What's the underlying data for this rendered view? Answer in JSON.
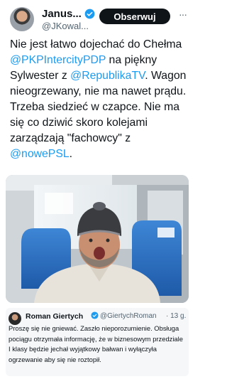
{
  "tweet": {
    "author_name": "Janus...",
    "author_handle": "@JKowal...",
    "follow_label": "Obserwuj",
    "more_label": "···",
    "text_parts": [
      "Nie jest łatwo dojechać do Chełma ",
      "@PKPIntercityPDP",
      " na piękny Sylwester z ",
      "@RepublikaTV",
      ". Wagon nieogrzewany, nie ma nawet prądu. Trzeba siedzieć w czapce. Nie ma się co dziwić skoro kolejami zarządzają \"fachowcy\" z ",
      "@nowePSL",
      "."
    ]
  },
  "reply": {
    "author_name": "Roman Giertych",
    "author_handle": "@GiertychRoman",
    "time": "· 13 g.",
    "text": "Proszę się nie gniewać. Zaszło nieporozumienie. Obsługa pociągu otrzymała informację, że w biznesowym przedziale I klasy będzie jechał wyjątkowy bałwan i wyłączyła ogrzewanie aby się nie roztopił."
  },
  "colors": {
    "mention": "#1d9bf0",
    "verified": "#1d9bf0",
    "follow_bg": "#0f1419",
    "reply_bg": "#f5f7f9"
  },
  "icons": {
    "verified": "verified-badge-icon",
    "more": "more-options-icon"
  }
}
